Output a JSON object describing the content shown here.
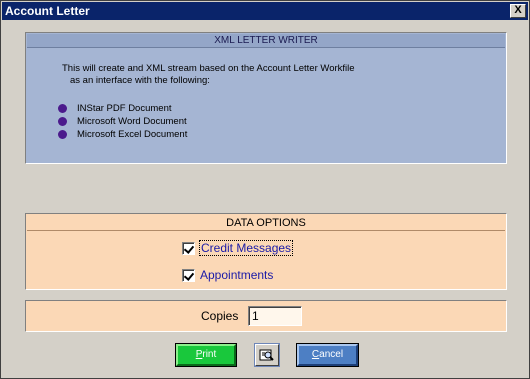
{
  "window": {
    "title": "Account Letter",
    "close_label": "X"
  },
  "xml_panel": {
    "header": "XML LETTER WRITER",
    "description_line1": "This will create and XML stream based on the Account Letter Workfile",
    "description_line2": "as an interface with the following:",
    "documents": [
      {
        "label": "INStar PDF Document"
      },
      {
        "label": "Microsoft Word Document"
      },
      {
        "label": "Microsoft Excel Document"
      }
    ],
    "bullet_color": "#4b1a8c",
    "background_color": "#a5b5d3"
  },
  "data_options": {
    "header": "DATA OPTIONS",
    "options": [
      {
        "label": "Credit Messages",
        "checked": true
      },
      {
        "label": "Appointments",
        "checked": true
      }
    ],
    "background_color": "#fbd8b6"
  },
  "copies": {
    "label": "Copies",
    "value": "1"
  },
  "buttons": {
    "print": {
      "label": "Print",
      "mnemonic": "P",
      "rest": "rint",
      "color": "#19c83c"
    },
    "preview": {
      "icon": "print-preview-icon"
    },
    "cancel": {
      "label": "Cancel",
      "mnemonic": "C",
      "rest": "ancel",
      "color": "#4d7fc4"
    }
  }
}
